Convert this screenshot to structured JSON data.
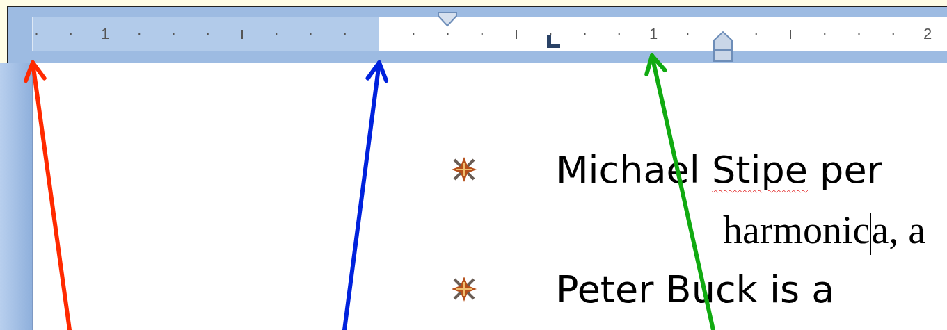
{
  "ruler": {
    "labels": [
      "1",
      "1",
      "2"
    ]
  },
  "document": {
    "bullets": [
      {
        "lines": [
          [
            {
              "text": "Michael "
            },
            {
              "text": "Stipe",
              "misspelled": true
            },
            {
              "text": " per"
            }
          ],
          [
            {
              "text": "harmonic",
              "cursor_after": true
            },
            {
              "text": "a, a"
            }
          ]
        ]
      },
      {
        "lines": [
          [
            {
              "text": "Peter Buck is a"
            }
          ]
        ]
      }
    ]
  },
  "arrows": [
    {
      "color": "#ff2a00"
    },
    {
      "color": "#0022dd"
    },
    {
      "color": "#11aa11"
    }
  ]
}
